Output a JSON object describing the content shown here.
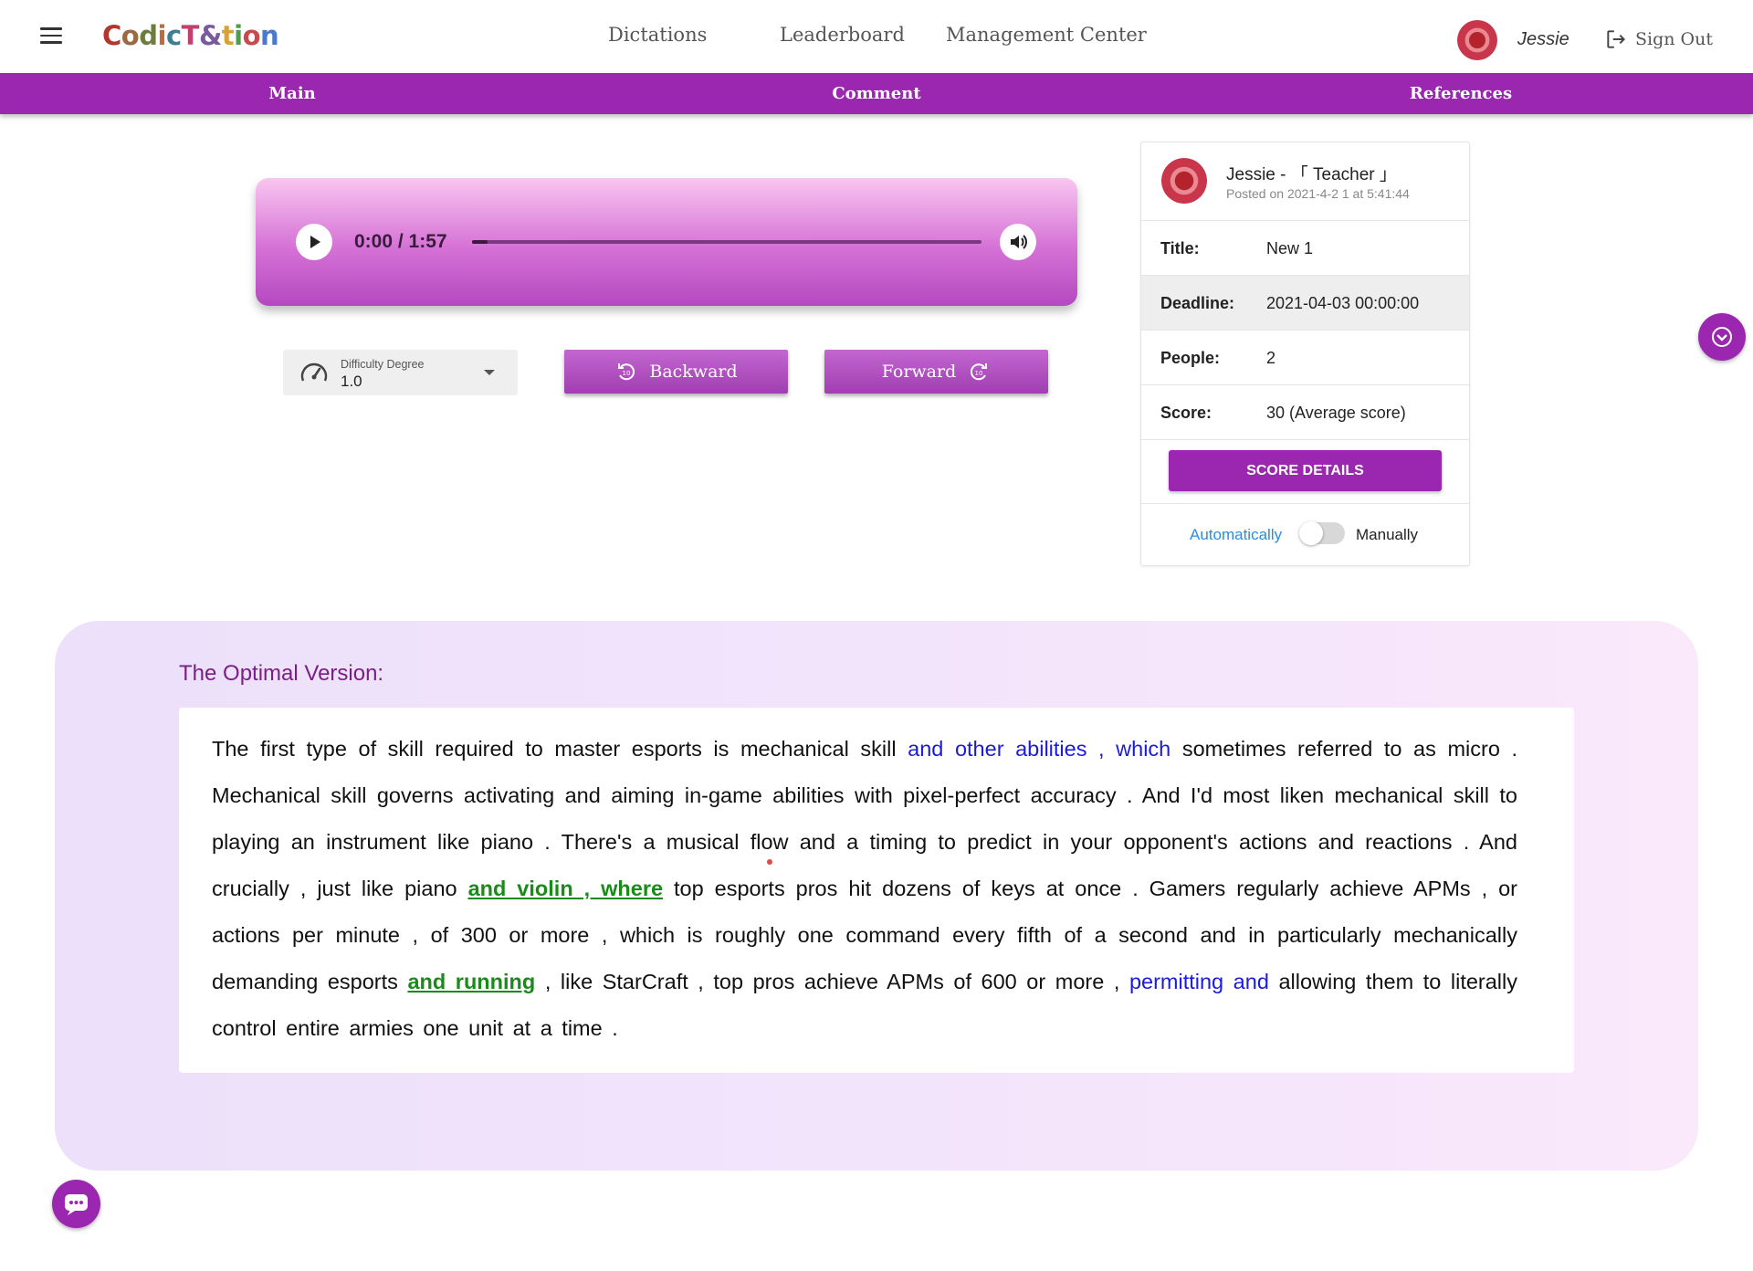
{
  "header": {
    "logo": [
      "C",
      "o",
      "d",
      "i",
      "c",
      "T",
      "&",
      "t",
      "i",
      "o",
      "n"
    ],
    "logo_colors": [
      "#b2362e",
      "#9b6a44",
      "#6d7d3e",
      "#c26a3a",
      "#3f7d94",
      "#c23f6e",
      "#7a5a9e",
      "#d7a236",
      "#4e9c4e",
      "#c94a4a",
      "#4a7ac9"
    ],
    "nav": [
      "Dictations",
      "Leaderboard",
      "Management Center"
    ],
    "user": "Jessie",
    "sign_out": "Sign Out"
  },
  "tabs": [
    "Main",
    "Comment",
    "References"
  ],
  "player": {
    "time": "0:00 / 1:57",
    "progress": 0.03
  },
  "controls": {
    "difficulty_label": "Difficulty Degree",
    "difficulty_value": "1.0",
    "backward": "Backward",
    "forward": "Forward"
  },
  "card": {
    "author": "Jessie - 「 Teacher 」",
    "posted": "Posted on 2021-4-2 1 at 5:41:44",
    "rows": [
      {
        "key": "Title:",
        "value": "New 1"
      },
      {
        "key": "Deadline:",
        "value": "2021-04-03 00:00:00"
      },
      {
        "key": "People:",
        "value": "2"
      },
      {
        "key": "Score:",
        "value": "30 (Average score)"
      }
    ],
    "score_button": "SCORE DETAILS",
    "mode_auto": "Automatically",
    "mode_manual": "Manually"
  },
  "optimal": {
    "title": "The Optimal Version:",
    "segments": [
      {
        "t": "The first type of skill required to master esports is mechanical skill ",
        "s": "plain"
      },
      {
        "t": "and other abilities , which",
        "s": "blue"
      },
      {
        "t": " sometimes referred to as micro . Mechanical skill governs activating and aiming in-game abilities with pixel-perfect accuracy . And I'd most liken mechanical skill to playing an instrument like piano . There's a musical ",
        "s": "plain"
      },
      {
        "t": "flow",
        "s": "dot"
      },
      {
        "t": " and a timing to predict in your opponent's actions and reactions . And crucially , just like piano ",
        "s": "plain"
      },
      {
        "t": "and violin , where",
        "s": "green"
      },
      {
        "t": " top esports pros hit dozens of keys at once . Gamers regularly achieve APMs , or actions per minute , of 300 or more , which is roughly one command every fifth of a second and in particularly mechanically demanding esports ",
        "s": "plain"
      },
      {
        "t": "and running",
        "s": "green"
      },
      {
        "t": " , like StarCraft , top pros achieve APMs of 600 or more , ",
        "s": "plain"
      },
      {
        "t": "permitting and",
        "s": "blue"
      },
      {
        "t": " allowing them to literally control entire armies one unit at a time .",
        "s": "plain"
      }
    ]
  }
}
